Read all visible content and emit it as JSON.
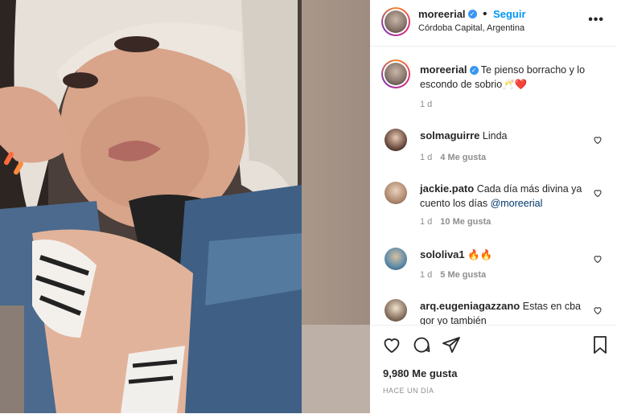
{
  "header": {
    "username": "moreerial",
    "follow_label": "Seguir",
    "location": "Córdoba Capital, Argentina",
    "more_icon": "more-icon"
  },
  "caption": {
    "username": "moreerial",
    "text": "Te pienso borracho y lo escondo de sobrio🥂❤️",
    "time": "1 d"
  },
  "comments": [
    {
      "username": "solmaguirre",
      "text": "Linda",
      "time": "1 d",
      "likes": "4 Me gusta"
    },
    {
      "username": "jackie.pato",
      "text": "Cada día más divina ya cuento los días",
      "mention": "@moreerial",
      "time": "1 d",
      "likes": "10 Me gusta"
    },
    {
      "username": "sololiva1",
      "text": "🔥🔥",
      "time": "1 d",
      "likes": "5 Me gusta"
    },
    {
      "username": "arq.eugeniagazzano",
      "text": "Estas en cba gor yo también"
    }
  ],
  "footer": {
    "likes": "9,980 Me gusta",
    "time_ago": "HACE UN DÍA"
  },
  "colors": {
    "link": "#0095f6",
    "verified": "#3897f0",
    "heart": "#ed4956"
  }
}
